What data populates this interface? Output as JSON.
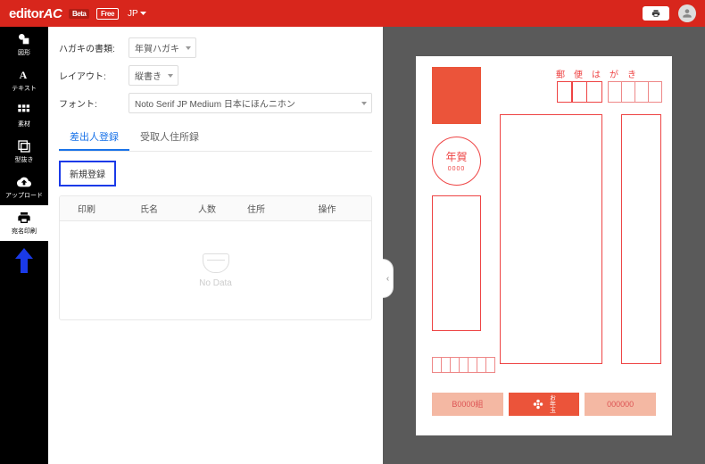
{
  "header": {
    "logo_editor": "editor",
    "logo_ac": "AC",
    "beta": "Beta",
    "free": "Free",
    "lang": "JP"
  },
  "sidebar": {
    "items": [
      {
        "label": "図形"
      },
      {
        "label": "テキスト"
      },
      {
        "label": "素材"
      },
      {
        "label": "型抜き"
      },
      {
        "label": "アップロード"
      },
      {
        "label": "宛名印刷"
      }
    ]
  },
  "settings": {
    "postcard_type_label": "ハガキの書類:",
    "postcard_type_value": "年賀ハガキ",
    "layout_label": "レイアウト:",
    "layout_value": "縦書き",
    "font_label": "フォント:",
    "font_value": "Noto Serif JP Medium 日本にほんニホン"
  },
  "tabs": {
    "sender": "差出人登録",
    "recipient": "受取人住所録"
  },
  "buttons": {
    "new_register": "新規登録"
  },
  "table": {
    "headers": {
      "print": "印刷",
      "name": "氏名",
      "count": "人数",
      "address": "住所",
      "action": "操作"
    },
    "no_data": "No Data"
  },
  "postcard": {
    "title": "郵便はがき",
    "nenga": "年賀",
    "nenga_num": "0000",
    "otoshidama": "お年玉",
    "bottom_left": "B0000組",
    "bottom_right": "000000"
  }
}
